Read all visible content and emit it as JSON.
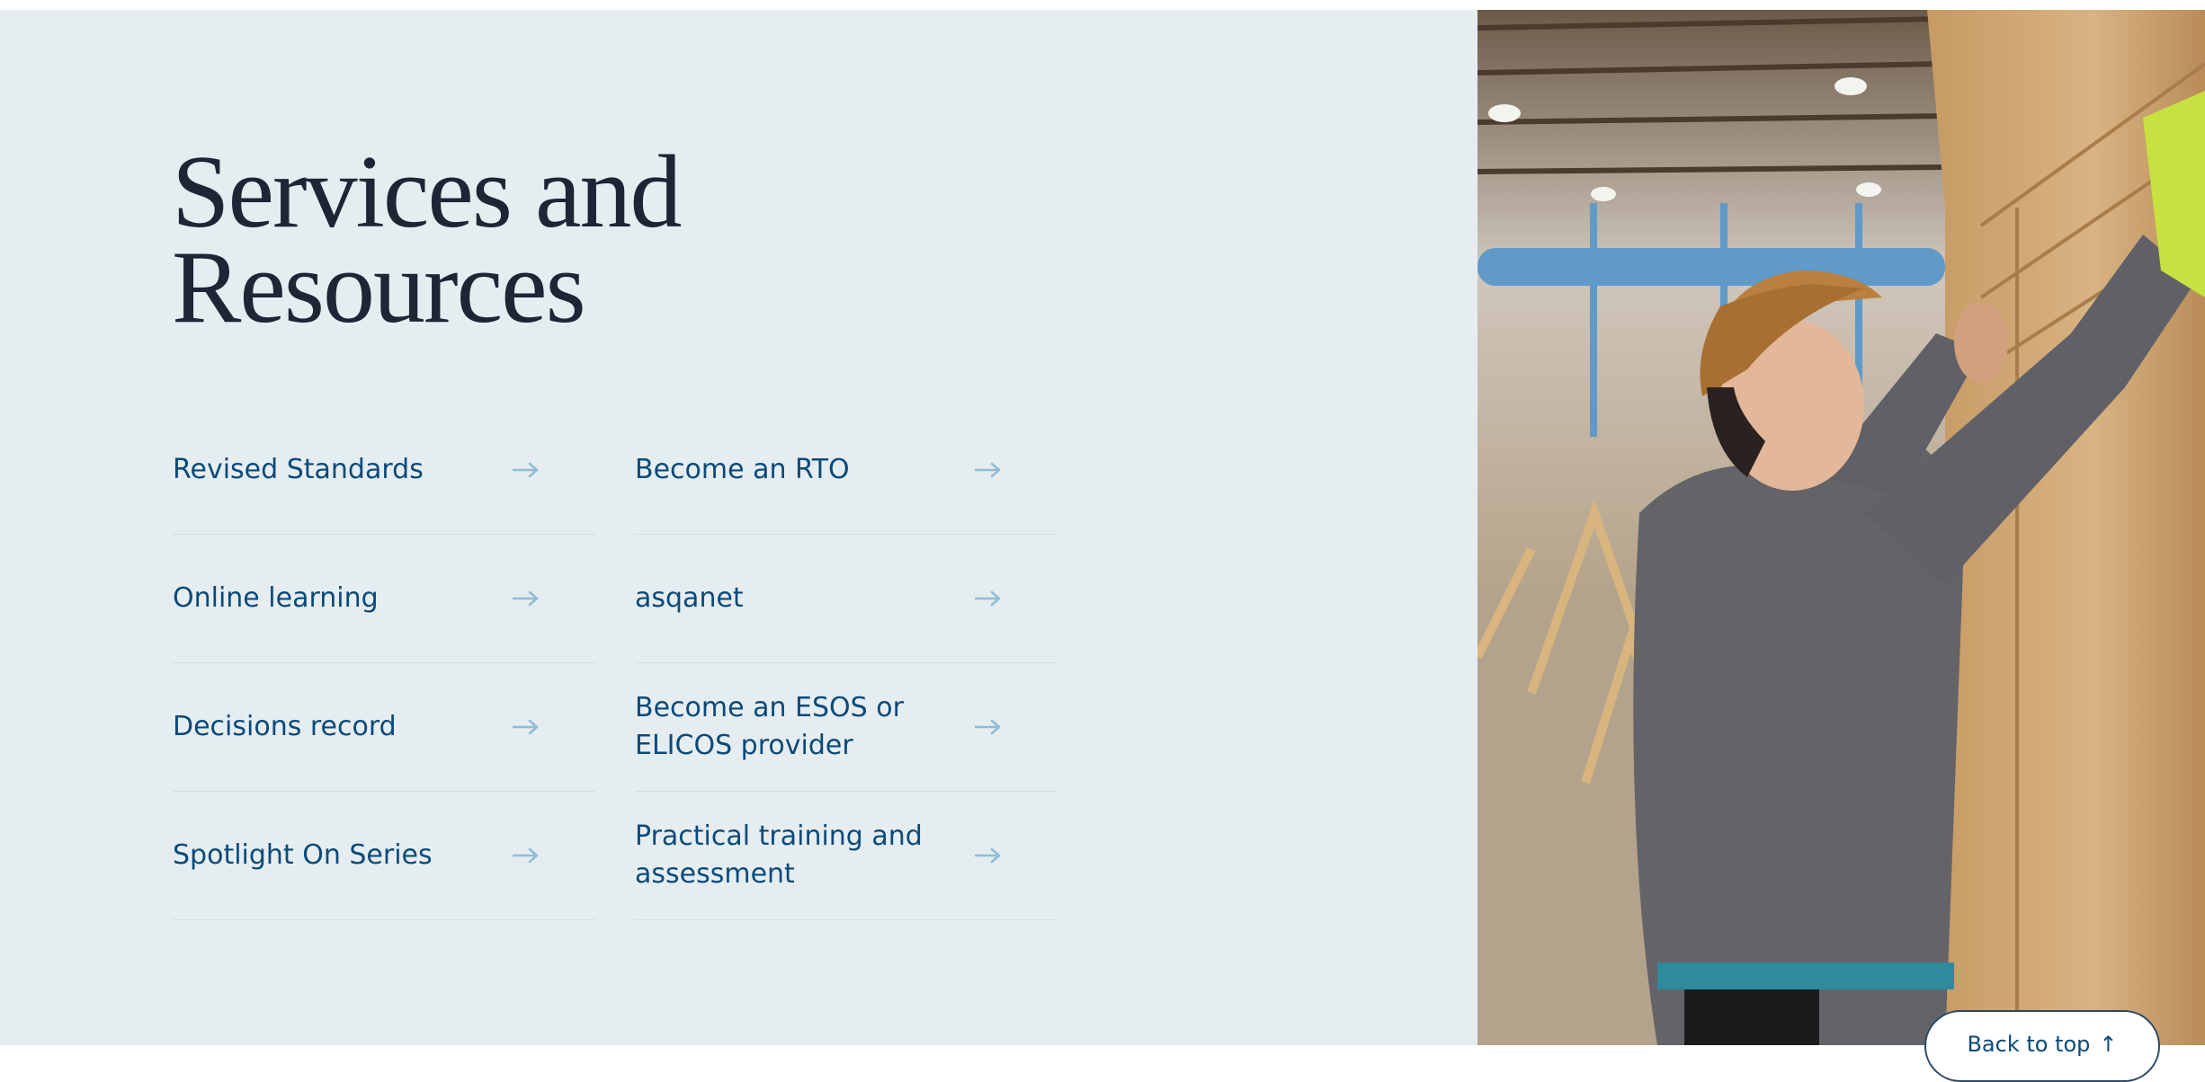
{
  "heading": {
    "line1": "Services and",
    "line2": "Resources"
  },
  "links": [
    {
      "label": "Revised Standards",
      "icon": "arrow-right-icon"
    },
    {
      "label": "Become an RTO",
      "icon": "arrow-right-icon"
    },
    {
      "label": "Online learning",
      "icon": "arrow-right-icon"
    },
    {
      "label": "asqanet",
      "icon": "arrow-right-icon"
    },
    {
      "label": "Decisions record",
      "icon": "arrow-right-icon"
    },
    {
      "label": "Become an ESOS or ELICOS provider",
      "icon": "arrow-right-icon"
    },
    {
      "label": "Spotlight On Series",
      "icon": "arrow-right-icon"
    },
    {
      "label": "Practical training and assessment",
      "icon": "arrow-right-icon"
    }
  ],
  "back_to_top": {
    "label": "Back to top",
    "icon": "arrow-up-icon"
  },
  "colors": {
    "panel_background": "#e6edf1",
    "heading_text": "#1e2535",
    "link_text": "#0a4a7a",
    "arrow": "#8fbcd6",
    "divider": "#d3dde3"
  }
}
